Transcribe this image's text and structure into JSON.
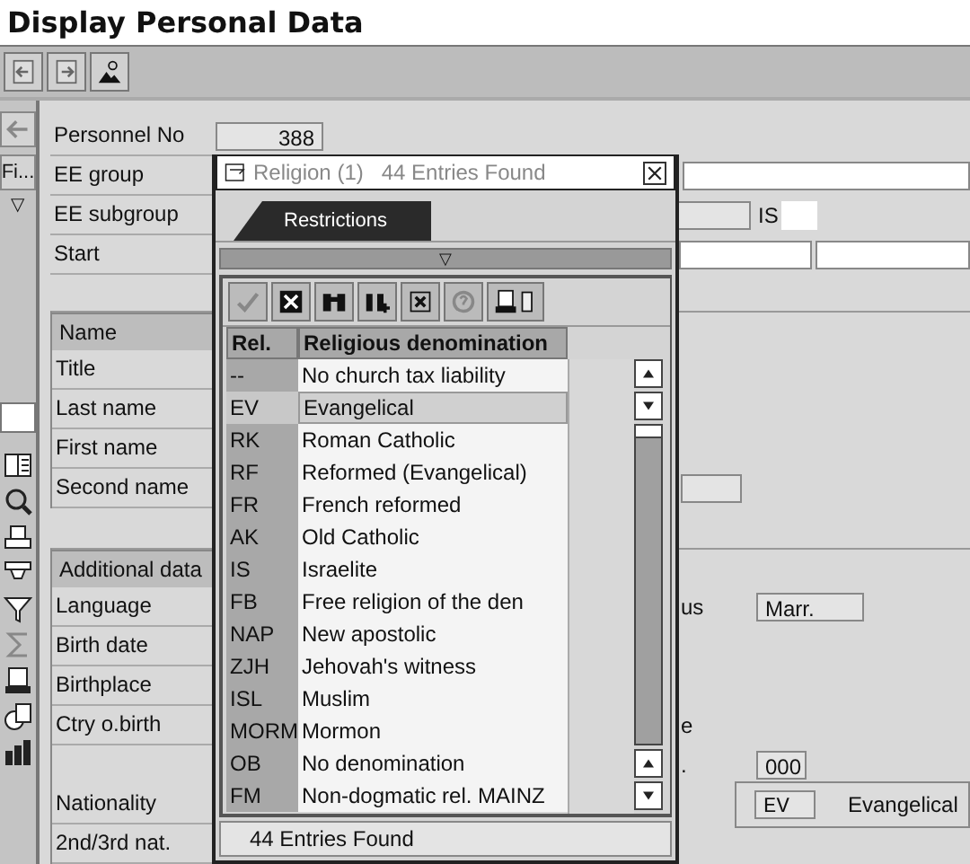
{
  "title": "Display Personal Data",
  "side": {
    "button": "Fi...",
    "marker": "▽"
  },
  "header_fields": [
    {
      "label": "Personnel No",
      "value": "388"
    },
    {
      "label": "EE group"
    },
    {
      "label": "EE subgroup",
      "value": "IS"
    },
    {
      "label": "Start"
    }
  ],
  "name_section": {
    "title": "Name",
    "fields": [
      "Title",
      "Last name",
      "First name",
      "Second name"
    ]
  },
  "additional_section": {
    "title": "Additional data",
    "rows": [
      {
        "label": "Language",
        "fragment": "us",
        "value": "Marr."
      },
      {
        "label": "Birth date"
      },
      {
        "label": "Birthplace"
      },
      {
        "label": "Ctry o.birth",
        "fragment": "e"
      },
      {
        "label": "",
        "fragment": ".",
        "value": "000"
      },
      {
        "label": "Nationality",
        "code": "EV",
        "value": "Evangelical"
      },
      {
        "label": "2nd/3rd nat."
      }
    ]
  },
  "popup": {
    "title": "Religion (1)",
    "found": "44 Entries Found",
    "tab": "Restrictions",
    "marker": "▽",
    "toolbar": [
      {
        "kind": "check",
        "disabled": true
      },
      {
        "kind": "cancel",
        "disabled": false
      },
      {
        "kind": "find",
        "disabled": false
      },
      {
        "kind": "findnext",
        "disabled": false
      },
      {
        "kind": "tree",
        "disabled": false
      },
      {
        "kind": "help",
        "disabled": true
      },
      {
        "kind": "print",
        "disabled": false
      }
    ],
    "columns": [
      "Rel.",
      "Religious denomination"
    ],
    "rows": [
      {
        "code": "--",
        "name": "No church tax liability",
        "selected": false
      },
      {
        "code": "EV",
        "name": "Evangelical",
        "selected": true
      },
      {
        "code": "RK",
        "name": "Roman Catholic",
        "selected": false
      },
      {
        "code": "RF",
        "name": "Reformed (Evangelical)",
        "selected": false
      },
      {
        "code": "FR",
        "name": "French reformed",
        "selected": false
      },
      {
        "code": "AK",
        "name": "Old Catholic",
        "selected": false
      },
      {
        "code": "IS",
        "name": "Israelite",
        "selected": false
      },
      {
        "code": "FB",
        "name": "Free religion of the den",
        "selected": false
      },
      {
        "code": "NAP",
        "name": "New apostolic",
        "selected": false
      },
      {
        "code": "ZJH",
        "name": "Jehovah's witness",
        "selected": false
      },
      {
        "code": "ISL",
        "name": "Muslim",
        "selected": false
      },
      {
        "code": "MORM",
        "name": "Mormon",
        "selected": false
      },
      {
        "code": "OB",
        "name": "No denomination",
        "selected": false
      },
      {
        "code": "FM",
        "name": "Non-dogmatic rel. MAINZ",
        "selected": false
      }
    ],
    "status": "44 Entries Found"
  }
}
